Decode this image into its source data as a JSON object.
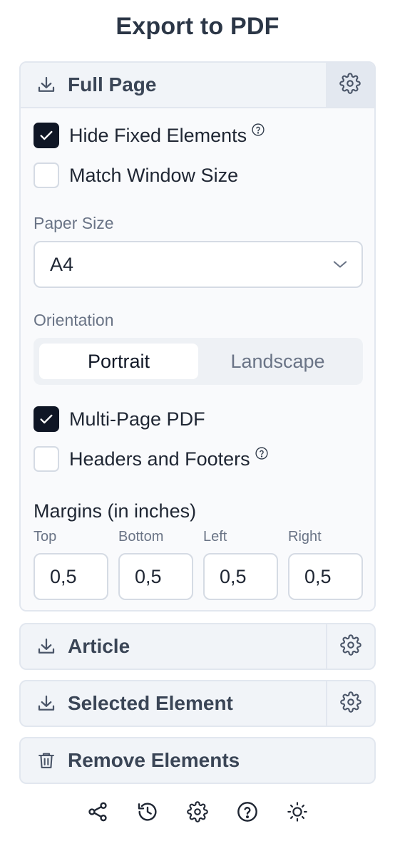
{
  "title": "Export to PDF",
  "full_page": {
    "label": "Full Page",
    "hide_fixed": {
      "label": "Hide Fixed Elements",
      "checked": true
    },
    "match_window": {
      "label": "Match Window Size",
      "checked": false
    },
    "paper_size": {
      "label": "Paper Size",
      "value": "A4"
    },
    "orientation": {
      "label": "Orientation",
      "options": [
        "Portrait",
        "Landscape"
      ],
      "selected": "Portrait"
    },
    "multi_page": {
      "label": "Multi-Page PDF",
      "checked": true
    },
    "headers_footers": {
      "label": "Headers and Footers",
      "checked": false
    },
    "margins": {
      "label": "Margins (in inches)",
      "fields": [
        {
          "label": "Top",
          "value": "0,5"
        },
        {
          "label": "Bottom",
          "value": "0,5"
        },
        {
          "label": "Left",
          "value": "0,5"
        },
        {
          "label": "Right",
          "value": "0,5"
        }
      ]
    }
  },
  "article": {
    "label": "Article"
  },
  "selected_element": {
    "label": "Selected Element"
  },
  "remove_elements": {
    "label": "Remove Elements"
  },
  "footer_icons": [
    "share-icon",
    "history-icon",
    "settings-icon",
    "help-icon",
    "theme-icon"
  ],
  "colors": {
    "accent": "#0f1625",
    "text": "#1f2633",
    "muted": "#6a7486",
    "border": "#e2e7ef"
  }
}
